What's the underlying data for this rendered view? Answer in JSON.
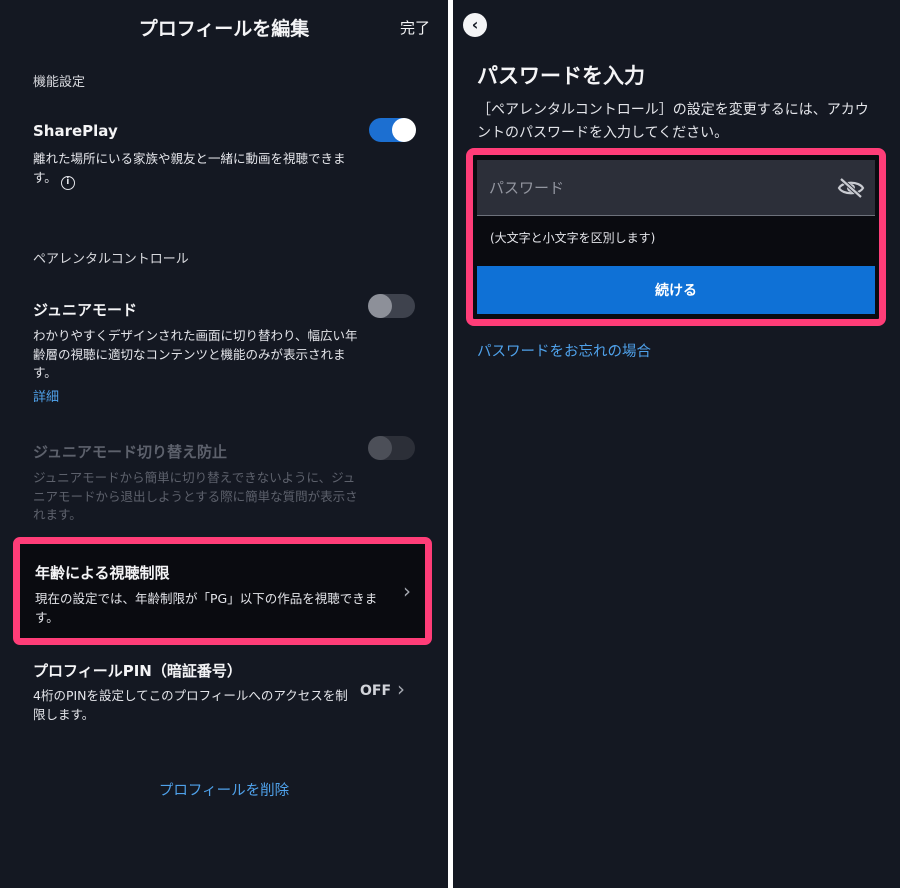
{
  "left": {
    "title": "プロフィールを編集",
    "done_label": "完了",
    "function_settings_label": "機能設定",
    "shareplay": {
      "title": "SharePlay",
      "description": "離れた場所にいる家族や親友と一緒に動画を視聴できます。",
      "toggle_state": "on"
    },
    "parental_controls_label": "ペアレンタルコントロール",
    "junior_mode": {
      "title": "ジュニアモード",
      "description": "わかりやすくデザインされた画面に切り替わり、幅広い年齢層の視聴に適切なコンテンツと機能のみが表示されます。",
      "detail_link": "詳細",
      "toggle_state": "off"
    },
    "junior_lock": {
      "title": "ジュニアモード切り替え防止",
      "description": "ジュニアモードから簡単に切り替えできないように、ジュニアモードから退出しようとする際に簡単な質問が表示されます。",
      "toggle_state": "disabled"
    },
    "age_restriction": {
      "title": "年齢による視聴制限",
      "description": "現在の設定では、年齢制限が「PG」以下の作品を視聴できます。"
    },
    "profile_pin": {
      "title": "プロフィールPIN（暗証番号）",
      "description": "4桁のPINを設定してこのプロフィールへのアクセスを制限します。",
      "status": "OFF"
    },
    "delete_profile": "プロフィールを削除"
  },
  "right": {
    "title": "パスワードを入力",
    "description": "［ペアレンタルコントロール］の設定を変更するには、アカウントのパスワードを入力してください。",
    "password_placeholder": "パスワード",
    "password_value": "",
    "hint": "(大文字と小文字を区別します)",
    "continue_label": "続ける",
    "forgot_link": "パスワードをお忘れの場合"
  },
  "colors": {
    "background": "#141822",
    "accent_blue": "#0f71d6",
    "link_blue": "#4fa1ea",
    "highlight_pink": "#ff3d78",
    "divider": "#ffffff"
  },
  "icons": {
    "info": "info-icon",
    "chevron": "chevron-right-icon",
    "back": "back-arrow-icon",
    "eye": "eye-off-icon"
  }
}
